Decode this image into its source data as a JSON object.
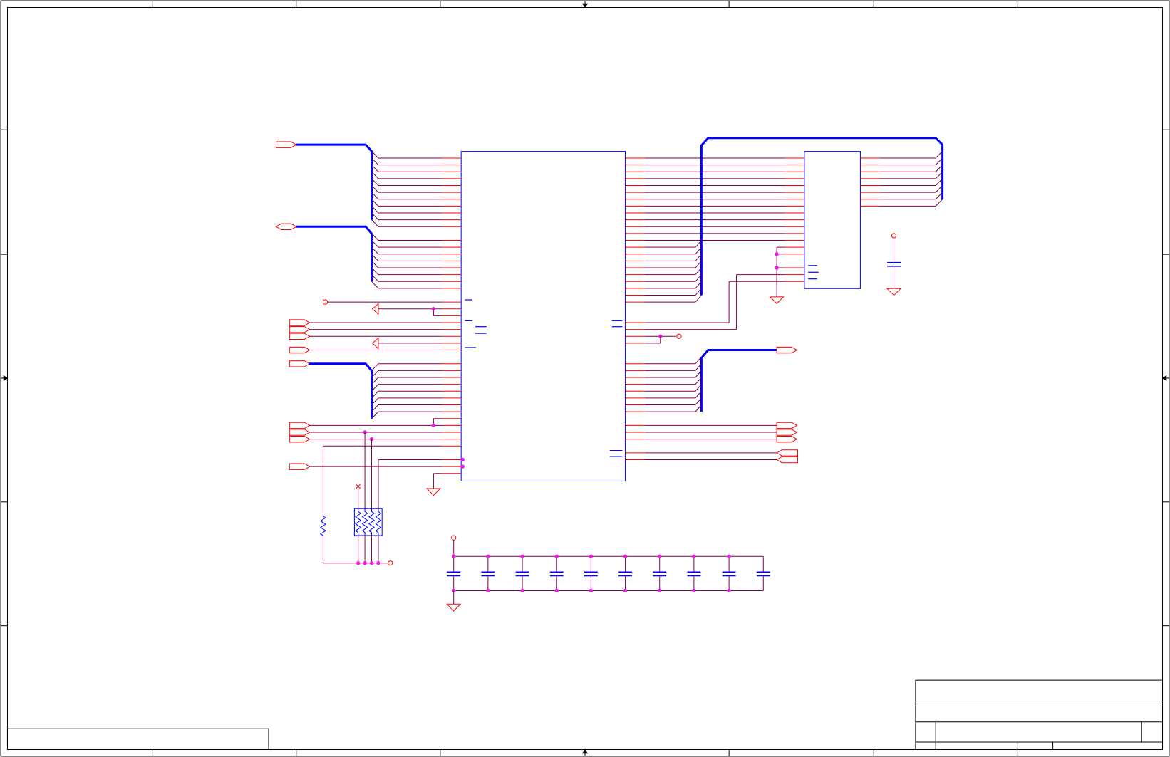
{
  "colors": {
    "background": "#ffffff",
    "frame": "#000000",
    "wire": "#80004a",
    "pin": "#ff0000",
    "bus": "#0000ff",
    "component_outline": "#0000ff",
    "junction": "#e61ee6",
    "port": "#ff0000",
    "power_symbol": "#ff0000"
  },
  "symbols": [
    "ground-icon",
    "power-icon",
    "capacitor-icon",
    "resistor-icon",
    "resistor-network-icon",
    "port-icon"
  ]
}
